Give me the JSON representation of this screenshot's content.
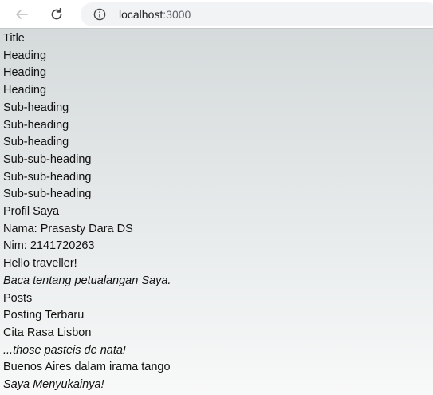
{
  "browser": {
    "url_host": "localhost",
    "url_port": ":3000"
  },
  "page": {
    "lines": [
      {
        "text": "Title",
        "italic": false
      },
      {
        "text": "Heading",
        "italic": false
      },
      {
        "text": "Heading",
        "italic": false
      },
      {
        "text": "Heading",
        "italic": false
      },
      {
        "text": "Sub-heading",
        "italic": false
      },
      {
        "text": "Sub-heading",
        "italic": false
      },
      {
        "text": "Sub-heading",
        "italic": false
      },
      {
        "text": "Sub-sub-heading",
        "italic": false
      },
      {
        "text": "Sub-sub-heading",
        "italic": false
      },
      {
        "text": "Sub-sub-heading",
        "italic": false
      },
      {
        "text": "Profil Saya",
        "italic": false
      },
      {
        "text": "Nama: Prasasty Dara DS",
        "italic": false
      },
      {
        "text": "Nim: 2141720263",
        "italic": false
      },
      {
        "text": "Hello traveller!",
        "italic": false
      },
      {
        "text": "Baca tentang petualangan Saya.",
        "italic": true
      },
      {
        "text": "Posts",
        "italic": false
      },
      {
        "text": "Posting Terbaru",
        "italic": false
      },
      {
        "text": "Cita Rasa Lisbon",
        "italic": false
      },
      {
        "text": "...those pasteis de nata!",
        "italic": true
      },
      {
        "text": "Buenos Aires dalam irama tango",
        "italic": false
      },
      {
        "text": "Saya Menyukainya!",
        "italic": true
      }
    ]
  }
}
